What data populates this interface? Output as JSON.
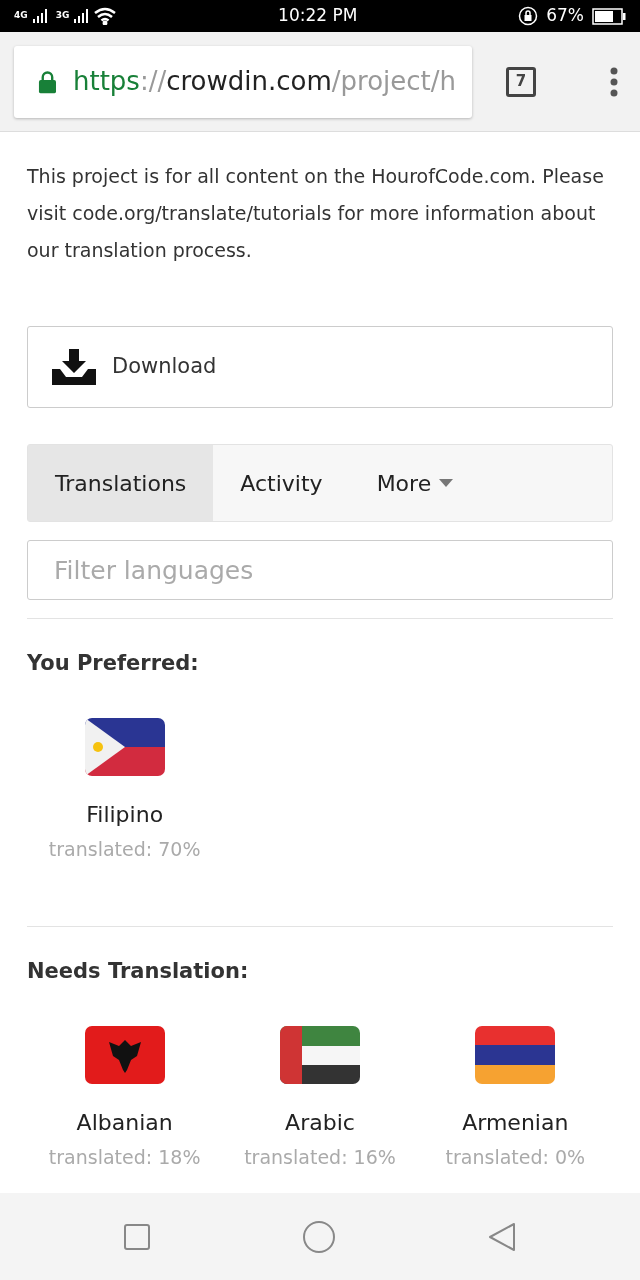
{
  "status_bar": {
    "network_1": "4G",
    "network_2": "3G",
    "time": "10:22 PM",
    "battery": "67%"
  },
  "browser": {
    "url": {
      "scheme": "https",
      "separator": "://",
      "host": "crowdin.com",
      "path": "/project/h"
    },
    "tab_count": "7"
  },
  "description": "This project is for all content on the HourofCode.com. Please visit code.org/translate/tutorials for more information about our translation process.",
  "download_button": "Download",
  "tabs": [
    {
      "label": "Translations",
      "selected": true
    },
    {
      "label": "Activity",
      "selected": false
    },
    {
      "label": "More",
      "selected": false,
      "kind": "dropdown"
    }
  ],
  "filter": {
    "placeholder": "Filter languages"
  },
  "sections": [
    {
      "title": "You Preferred:",
      "languages": [
        {
          "name": "Filipino",
          "progress": "translated: 70%",
          "kind": "philippines"
        }
      ]
    },
    {
      "title": "Needs Translation:",
      "languages": [
        {
          "name": "Albanian",
          "progress": "translated: 18%",
          "kind": "albania"
        },
        {
          "name": "Arabic",
          "progress": "translated: 16%",
          "kind": "uae"
        },
        {
          "name": "Armenian",
          "progress": "translated: 0%",
          "kind": "armenia"
        }
      ]
    }
  ]
}
